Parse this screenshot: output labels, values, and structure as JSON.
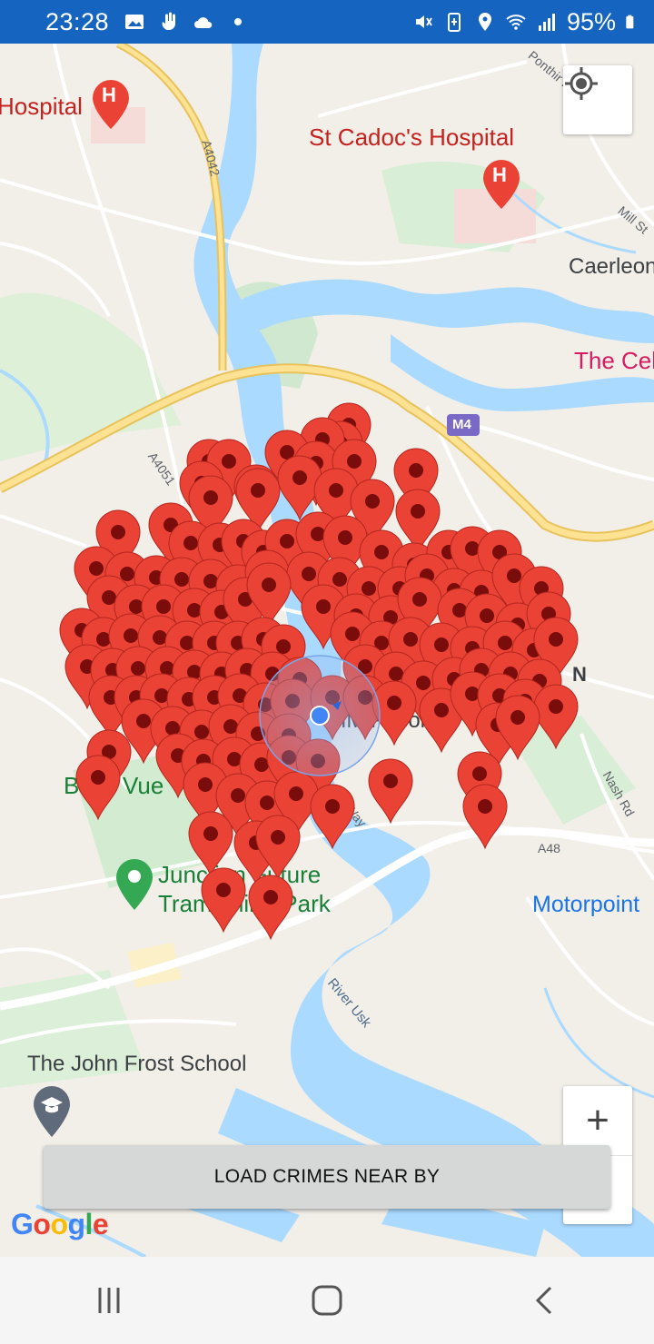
{
  "status_bar": {
    "time": "23:28",
    "battery": "95%",
    "left_icons": [
      "image-icon",
      "hand-icon",
      "cloud-icon",
      "dot-icon"
    ],
    "right_icons": [
      "mute-icon",
      "battery-saver-icon",
      "location-icon",
      "wifi-icon",
      "signal-icon",
      "battery-icon"
    ]
  },
  "map": {
    "labels": {
      "hospital_left": "Hospital",
      "st_cadocs": "St Cadoc's Hospital",
      "caerleon": "Caerleon",
      "the_cel": "The Cel",
      "belle_vue": "Belle Vue",
      "junction_line1": "Junction Future",
      "junction_line2": "Trampoline Park",
      "motorpoint": "Motorpoint",
      "john_frost": "The John Frost School",
      "hm_prison": "HM Prison",
      "n_label": "N",
      "a4042": "A4042",
      "a4051": "A4051",
      "m4": "M4",
      "a48": "A48",
      "nash_rd": "Nash Rd",
      "mill_st": "Mill St",
      "ponthir": "Ponthir Rd",
      "river_usk": "River Usk",
      "way": "Way"
    },
    "colors": {
      "marker": "#ea4335",
      "marker_dot": "#7b0c0c",
      "water": "#aadaff",
      "motorway": "#f9d56e",
      "park": "#c5e8c5"
    }
  },
  "controls": {
    "locate_icon": "my-location-icon",
    "zoom_in": "+",
    "zoom_out": "−"
  },
  "load_button": {
    "label": "LOAD CRIMES NEAR BY"
  },
  "google_logo": {
    "letters": [
      "G",
      "o",
      "o",
      "g",
      "l",
      "e"
    ],
    "colors": [
      "#4285f4",
      "#ea4335",
      "#fbbc05",
      "#4285f4",
      "#34a853",
      "#ea4335"
    ]
  },
  "nav_bar": {
    "items": [
      "recents-icon",
      "home-icon",
      "back-icon"
    ]
  }
}
